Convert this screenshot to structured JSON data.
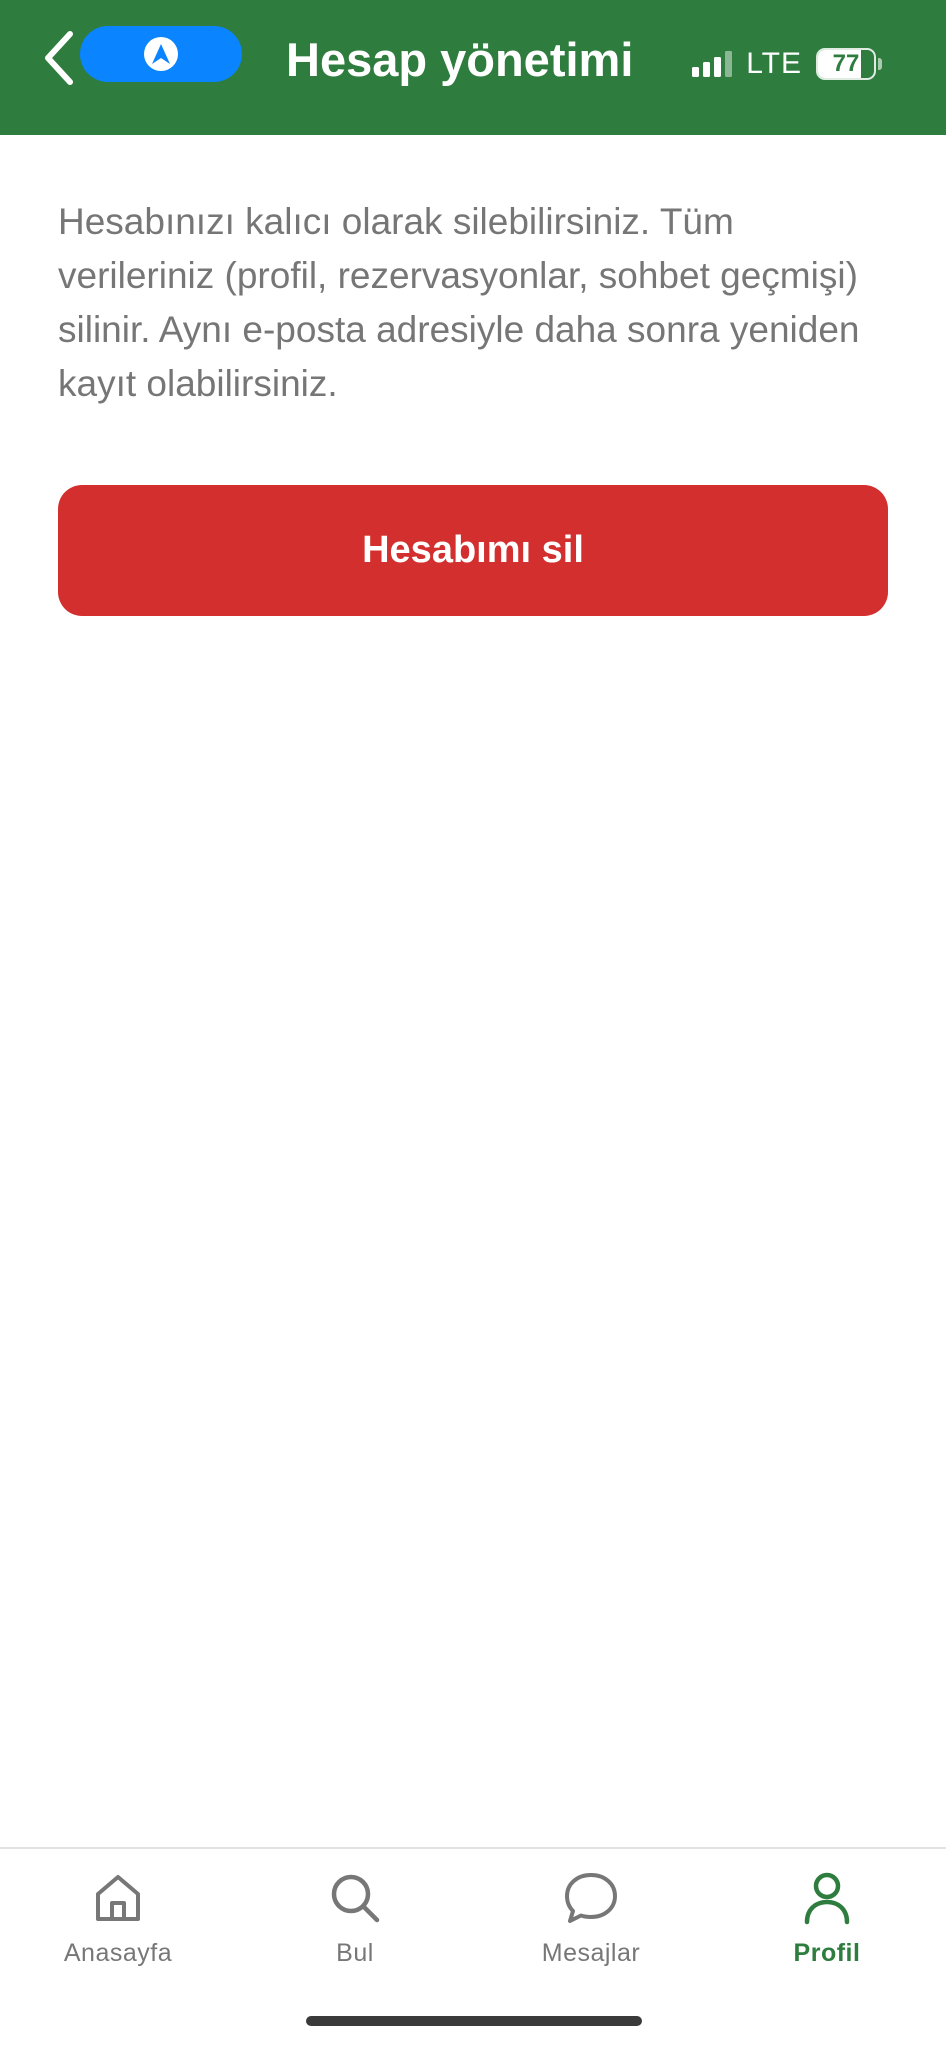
{
  "header": {
    "title": "Hesap yönetimi",
    "background_color": "#2e7d3e",
    "back_icon": "chevron-left-icon",
    "nav_pill_icon": "navigation-arrow-icon",
    "nav_pill_color": "#0a84ff"
  },
  "status_bar": {
    "network": "LTE",
    "signal_bars": 3,
    "signal_bars_total": 4,
    "battery": "77",
    "battery_level": 0.77
  },
  "main": {
    "description": "Hesabınızı kalıcı olarak silebilirsiniz. Tüm verileriniz (profil, rezervasyonlar, sohbet geçmişi) silinir. Aynı e-posta adresiyle daha sonra yeniden kayıt olabilirsiniz.",
    "delete_button_label": "Hesabımı sil",
    "delete_button_color": "#d32f2f"
  },
  "tabbar": {
    "active_color": "#2e7d3e",
    "items": [
      {
        "label": "Anasayfa",
        "icon": "home-icon",
        "active": false
      },
      {
        "label": "Bul",
        "icon": "search-icon",
        "active": false
      },
      {
        "label": "Mesajlar",
        "icon": "chat-bubble-icon",
        "active": false
      },
      {
        "label": "Profil",
        "icon": "person-icon",
        "active": true
      }
    ]
  }
}
